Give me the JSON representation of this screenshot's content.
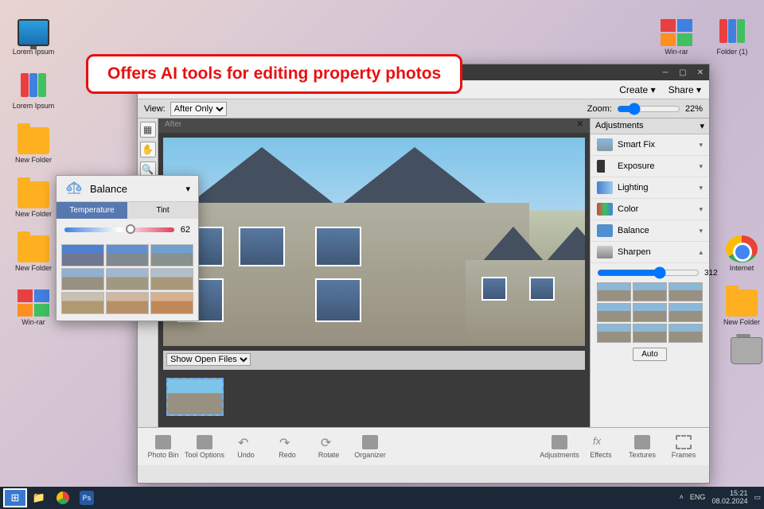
{
  "annotation": "Offers AI tools for editing property photos",
  "desktop": {
    "icons_left": [
      {
        "label": "Lorem Ipsum",
        "type": "monitor"
      },
      {
        "label": "Lorem Ipsum",
        "type": "books"
      },
      {
        "label": "New Folder",
        "type": "folder"
      },
      {
        "label": "New Folder",
        "type": "folder"
      },
      {
        "label": "New Folder",
        "type": "folder"
      },
      {
        "label": "Win-rar",
        "type": "winrar"
      }
    ],
    "icons_right": [
      {
        "label": "Win-rar",
        "type": "winrar"
      },
      {
        "label": "Folder (1)",
        "type": "books"
      },
      {
        "label": "Internet",
        "type": "chrome"
      },
      {
        "label": "New Folder",
        "type": "folder"
      },
      {
        "label": "",
        "type": "trash"
      }
    ]
  },
  "app": {
    "topbar": {
      "create": "Create",
      "share": "Share"
    },
    "workstrip": {
      "view_label": "View:",
      "view_value": "After Only",
      "zoom_label": "Zoom:",
      "zoom_value": "22%"
    },
    "canvas_tab": "After",
    "openfiles": "Show Open Files",
    "adjustments": {
      "title": "Adjustments",
      "items": [
        "Smart Fix",
        "Exposure",
        "Lighting",
        "Color",
        "Balance",
        "Sharpen"
      ],
      "sharpen_value": "312",
      "auto": "Auto"
    },
    "bottombar_left": [
      "Photo Bin",
      "Tool Options",
      "Undo",
      "Redo",
      "Rotate",
      "Organizer"
    ],
    "bottombar_right": [
      "Adjustments",
      "Effects",
      "Textures",
      "Frames"
    ]
  },
  "balance": {
    "title": "Balance",
    "tab_active": "Temperature",
    "tab_inactive": "Tint",
    "value": "62"
  },
  "taskbar": {
    "lang": "ENG",
    "time": "15:21",
    "date": "08.02.2024"
  }
}
